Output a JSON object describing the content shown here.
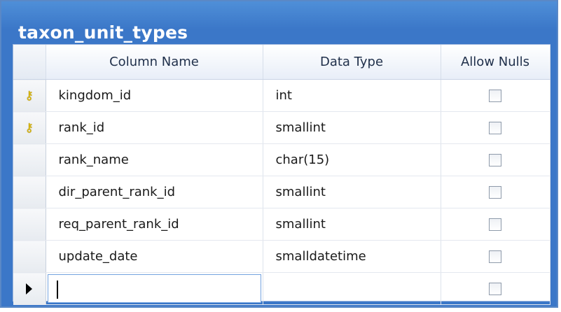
{
  "table_name": "taxon_unit_types",
  "columns": {
    "column_name": "Column Name",
    "data_type": "Data Type",
    "allow_nulls": "Allow Nulls"
  },
  "rows": [
    {
      "name": "kingdom_id",
      "type": "int",
      "primary_key": true,
      "allow_nulls": false
    },
    {
      "name": "rank_id",
      "type": "smallint",
      "primary_key": true,
      "allow_nulls": false
    },
    {
      "name": "rank_name",
      "type": "char(15)",
      "primary_key": false,
      "allow_nulls": false
    },
    {
      "name": "dir_parent_rank_id",
      "type": "smallint",
      "primary_key": false,
      "allow_nulls": false
    },
    {
      "name": "req_parent_rank_id",
      "type": "smallint",
      "primary_key": false,
      "allow_nulls": false
    },
    {
      "name": "update_date",
      "type": "smalldatetime",
      "primary_key": false,
      "allow_nulls": false
    }
  ],
  "new_row": {
    "name": "",
    "type": "",
    "allow_nulls": false
  },
  "icons": {
    "primary_key": "key-icon",
    "current_row": "row-pointer-icon"
  },
  "colors": {
    "title_bar": "#3b77c8",
    "key": "#d8b400"
  }
}
